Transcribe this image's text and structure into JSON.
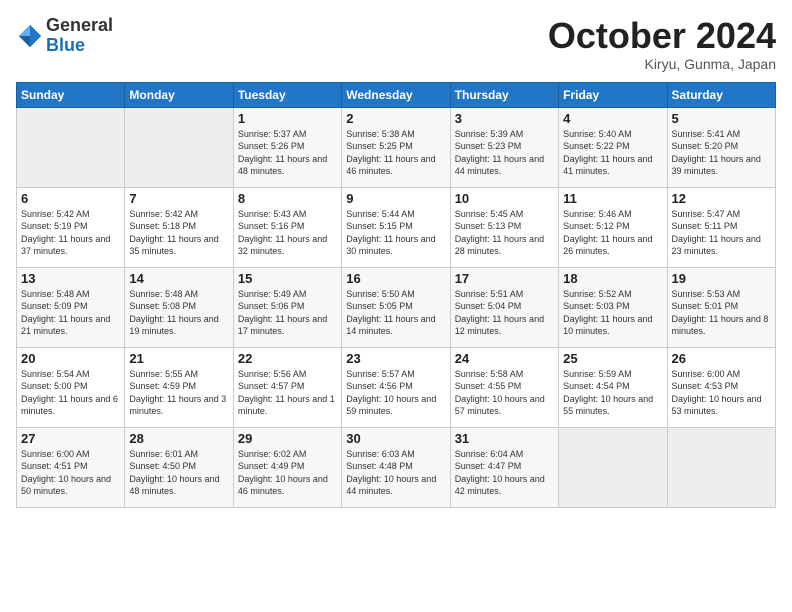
{
  "header": {
    "logo_general": "General",
    "logo_blue": "Blue",
    "month_title": "October 2024",
    "location": "Kiryu, Gunma, Japan"
  },
  "days_of_week": [
    "Sunday",
    "Monday",
    "Tuesday",
    "Wednesday",
    "Thursday",
    "Friday",
    "Saturday"
  ],
  "weeks": [
    [
      {
        "day": "",
        "info": ""
      },
      {
        "day": "",
        "info": ""
      },
      {
        "day": "1",
        "info": "Sunrise: 5:37 AM\nSunset: 5:26 PM\nDaylight: 11 hours and 48 minutes."
      },
      {
        "day": "2",
        "info": "Sunrise: 5:38 AM\nSunset: 5:25 PM\nDaylight: 11 hours and 46 minutes."
      },
      {
        "day": "3",
        "info": "Sunrise: 5:39 AM\nSunset: 5:23 PM\nDaylight: 11 hours and 44 minutes."
      },
      {
        "day": "4",
        "info": "Sunrise: 5:40 AM\nSunset: 5:22 PM\nDaylight: 11 hours and 41 minutes."
      },
      {
        "day": "5",
        "info": "Sunrise: 5:41 AM\nSunset: 5:20 PM\nDaylight: 11 hours and 39 minutes."
      }
    ],
    [
      {
        "day": "6",
        "info": "Sunrise: 5:42 AM\nSunset: 5:19 PM\nDaylight: 11 hours and 37 minutes."
      },
      {
        "day": "7",
        "info": "Sunrise: 5:42 AM\nSunset: 5:18 PM\nDaylight: 11 hours and 35 minutes."
      },
      {
        "day": "8",
        "info": "Sunrise: 5:43 AM\nSunset: 5:16 PM\nDaylight: 11 hours and 32 minutes."
      },
      {
        "day": "9",
        "info": "Sunrise: 5:44 AM\nSunset: 5:15 PM\nDaylight: 11 hours and 30 minutes."
      },
      {
        "day": "10",
        "info": "Sunrise: 5:45 AM\nSunset: 5:13 PM\nDaylight: 11 hours and 28 minutes."
      },
      {
        "day": "11",
        "info": "Sunrise: 5:46 AM\nSunset: 5:12 PM\nDaylight: 11 hours and 26 minutes."
      },
      {
        "day": "12",
        "info": "Sunrise: 5:47 AM\nSunset: 5:11 PM\nDaylight: 11 hours and 23 minutes."
      }
    ],
    [
      {
        "day": "13",
        "info": "Sunrise: 5:48 AM\nSunset: 5:09 PM\nDaylight: 11 hours and 21 minutes."
      },
      {
        "day": "14",
        "info": "Sunrise: 5:48 AM\nSunset: 5:08 PM\nDaylight: 11 hours and 19 minutes."
      },
      {
        "day": "15",
        "info": "Sunrise: 5:49 AM\nSunset: 5:06 PM\nDaylight: 11 hours and 17 minutes."
      },
      {
        "day": "16",
        "info": "Sunrise: 5:50 AM\nSunset: 5:05 PM\nDaylight: 11 hours and 14 minutes."
      },
      {
        "day": "17",
        "info": "Sunrise: 5:51 AM\nSunset: 5:04 PM\nDaylight: 11 hours and 12 minutes."
      },
      {
        "day": "18",
        "info": "Sunrise: 5:52 AM\nSunset: 5:03 PM\nDaylight: 11 hours and 10 minutes."
      },
      {
        "day": "19",
        "info": "Sunrise: 5:53 AM\nSunset: 5:01 PM\nDaylight: 11 hours and 8 minutes."
      }
    ],
    [
      {
        "day": "20",
        "info": "Sunrise: 5:54 AM\nSunset: 5:00 PM\nDaylight: 11 hours and 6 minutes."
      },
      {
        "day": "21",
        "info": "Sunrise: 5:55 AM\nSunset: 4:59 PM\nDaylight: 11 hours and 3 minutes."
      },
      {
        "day": "22",
        "info": "Sunrise: 5:56 AM\nSunset: 4:57 PM\nDaylight: 11 hours and 1 minute."
      },
      {
        "day": "23",
        "info": "Sunrise: 5:57 AM\nSunset: 4:56 PM\nDaylight: 10 hours and 59 minutes."
      },
      {
        "day": "24",
        "info": "Sunrise: 5:58 AM\nSunset: 4:55 PM\nDaylight: 10 hours and 57 minutes."
      },
      {
        "day": "25",
        "info": "Sunrise: 5:59 AM\nSunset: 4:54 PM\nDaylight: 10 hours and 55 minutes."
      },
      {
        "day": "26",
        "info": "Sunrise: 6:00 AM\nSunset: 4:53 PM\nDaylight: 10 hours and 53 minutes."
      }
    ],
    [
      {
        "day": "27",
        "info": "Sunrise: 6:00 AM\nSunset: 4:51 PM\nDaylight: 10 hours and 50 minutes."
      },
      {
        "day": "28",
        "info": "Sunrise: 6:01 AM\nSunset: 4:50 PM\nDaylight: 10 hours and 48 minutes."
      },
      {
        "day": "29",
        "info": "Sunrise: 6:02 AM\nSunset: 4:49 PM\nDaylight: 10 hours and 46 minutes."
      },
      {
        "day": "30",
        "info": "Sunrise: 6:03 AM\nSunset: 4:48 PM\nDaylight: 10 hours and 44 minutes."
      },
      {
        "day": "31",
        "info": "Sunrise: 6:04 AM\nSunset: 4:47 PM\nDaylight: 10 hours and 42 minutes."
      },
      {
        "day": "",
        "info": ""
      },
      {
        "day": "",
        "info": ""
      }
    ]
  ]
}
